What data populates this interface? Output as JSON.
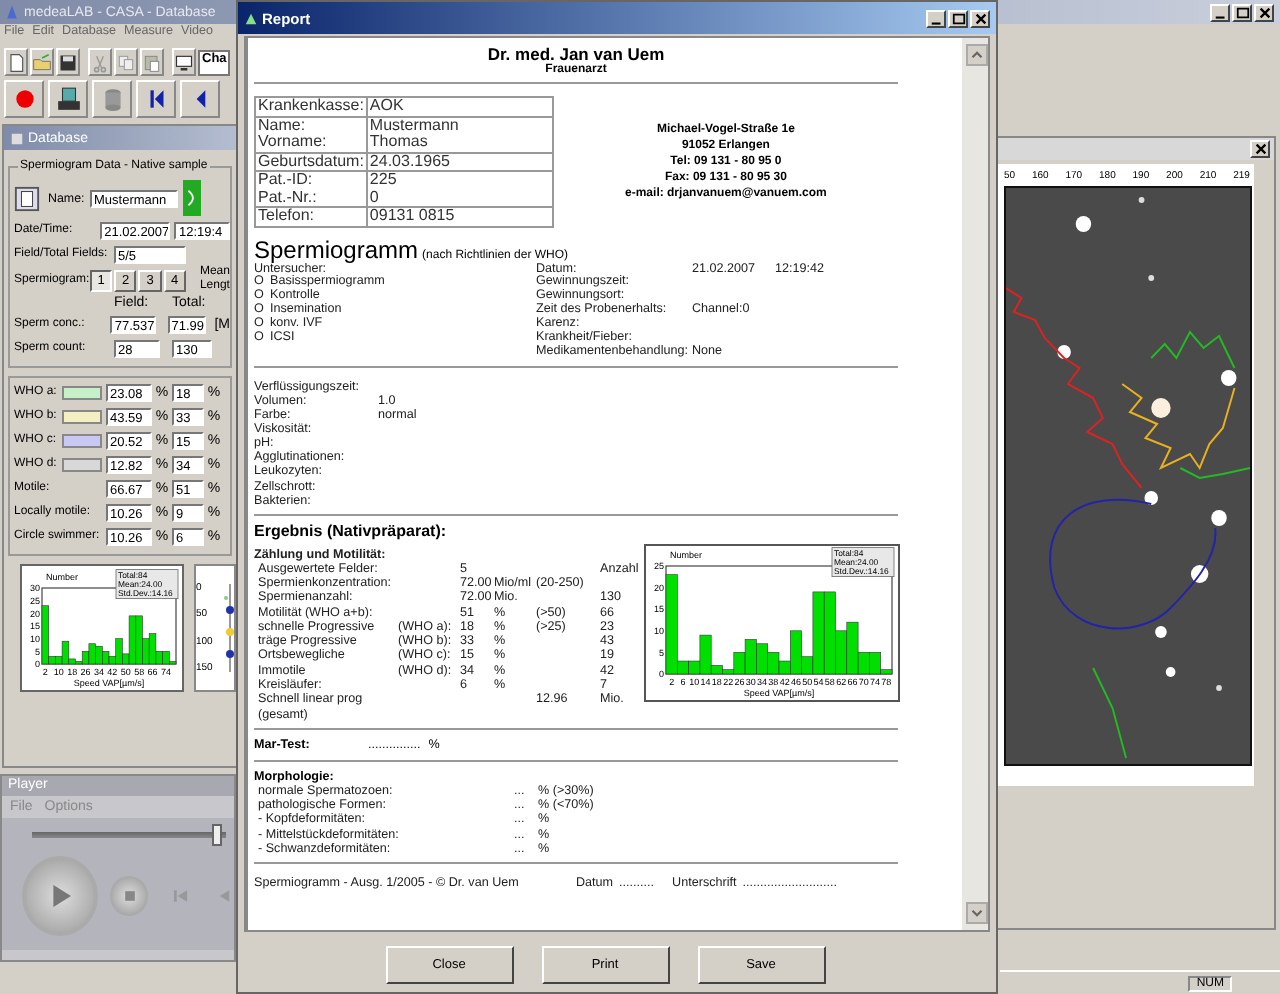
{
  "app_window": {
    "title": "medeaLAB - CASA - Database",
    "menu": [
      "File",
      "Edit",
      "Database",
      "Measure",
      "Video"
    ],
    "toolbar_combo": "Cha"
  },
  "database": {
    "title": "Database",
    "group_title": "Spermiogram Data - Native sample",
    "name_label": "Name:",
    "name_value": "Mustermann",
    "datetime_label": "Date/Time:",
    "date": "21.02.2007",
    "time": "12:19:4",
    "fields_label": "Field/Total Fields:",
    "fields_value": "5/5",
    "spermiogram_label": "Spermiogram:",
    "spermiogram_tabs": [
      {
        "label": "1",
        "selected": true
      },
      {
        "label": "2",
        "selected": false
      },
      {
        "label": "3",
        "selected": false
      },
      {
        "label": "4",
        "selected": false
      }
    ],
    "side_labels": [
      "Mean",
      "Lengt"
    ],
    "col_headers": [
      "Field:",
      "Total:"
    ],
    "metrics": [
      {
        "label": "Sperm conc.:",
        "field": "77.537",
        "total": "71.99",
        "unit": "[M"
      },
      {
        "label": "Sperm count:",
        "field": "28",
        "total": "130"
      }
    ],
    "who_rows": [
      {
        "label": "WHO a:",
        "color": "#c8f0c8",
        "field": "23.08",
        "field_unit": "%",
        "total": "18",
        "total_unit": "%"
      },
      {
        "label": "WHO b:",
        "color": "#f4eec0",
        "field": "43.59",
        "field_unit": "%",
        "total": "33",
        "total_unit": "%"
      },
      {
        "label": "WHO c:",
        "color": "#c8c8f4",
        "field": "20.52",
        "field_unit": "%",
        "total": "15",
        "total_unit": "%"
      },
      {
        "label": "WHO d:",
        "color": "#d8d8d8",
        "field": "12.82",
        "field_unit": "%",
        "total": "34",
        "total_unit": "%"
      },
      {
        "label": "Motile:",
        "field": "66.67",
        "field_unit": "%",
        "total": "51",
        "total_unit": "%"
      },
      {
        "label": "Locally motile:",
        "field": "10.26",
        "field_unit": "%",
        "total": "9",
        "total_unit": "%"
      },
      {
        "label": "Circle swimmer:",
        "field": "10.26",
        "field_unit": "%",
        "total": "6",
        "total_unit": "%"
      }
    ],
    "chart_data": {
      "type": "bar",
      "xlabel": "Speed VAP[µm/s]",
      "x": [
        2,
        6,
        10,
        14,
        18,
        22,
        26,
        30,
        34,
        38,
        42,
        46,
        50,
        54,
        58,
        62,
        66,
        70,
        74,
        78
      ],
      "series": [
        {
          "name": "Number",
          "color": "#00e000",
          "values": [
            23,
            3,
            3,
            9,
            2,
            1,
            5,
            8,
            7,
            5,
            3,
            10,
            4,
            19,
            19,
            10,
            12,
            5,
            5,
            1
          ]
        }
      ],
      "xlim": [
        0,
        80
      ],
      "ylim": [
        0,
        30
      ],
      "xticks": [
        2,
        10,
        18,
        26,
        34,
        42,
        50,
        58,
        66,
        74
      ],
      "yticks": [
        0,
        5,
        10,
        15,
        20,
        25,
        30
      ]
    },
    "chart_legend": [
      "Total:84",
      "Mean:24.00",
      "Std.Dev.:14.16"
    ],
    "side_plot_ticks": [
      "0",
      "50",
      "100",
      "150"
    ]
  },
  "player": {
    "title": "Player",
    "menu": [
      "File",
      "Options"
    ],
    "position": {
      "level": 0.98
    }
  },
  "report": {
    "title": "Report",
    "doctor": "Dr. med. Jan van Uem",
    "specialty": "Frauenarzt",
    "patient_table": [
      {
        "labels": [
          "Krankenkasse:"
        ],
        "values": [
          "AOK"
        ]
      },
      {
        "labels": [
          "Name:",
          "Vorname:"
        ],
        "values": [
          "Mustermann",
          "Thomas"
        ]
      },
      {
        "labels": [
          "Geburtsdatum:"
        ],
        "values": [
          "24.03.1965"
        ]
      },
      {
        "labels": [
          "Pat.-ID:",
          "Pat.-Nr.:"
        ],
        "values": [
          "225",
          "0"
        ]
      },
      {
        "labels": [
          "Telefon:"
        ],
        "values": [
          "09131 0815"
        ]
      }
    ],
    "address": [
      "Michael-Vogel-Straße 1e",
      "91052 Erlangen",
      "Tel: 09 131 - 80 95 0",
      "Fax: 09 131 - 80 95 30",
      "e-mail: drjanvanuem@vanuem.com"
    ],
    "section_title": "Spermiogramm",
    "section_subtitle": "(nach Richtlinien der WHO)",
    "examiner_label": "Untersucher:",
    "exam_types": [
      {
        "mark": "O",
        "label": "Basisspermiogramm"
      },
      {
        "mark": "O",
        "label": "Kontrolle"
      },
      {
        "mark": "O",
        "label": "Insemination"
      },
      {
        "mark": "O",
        "label": "konv. IVF"
      },
      {
        "mark": "O",
        "label": "ICSI"
      }
    ],
    "sample_info": [
      {
        "label": "Datum:",
        "value": "21.02.2007",
        "value_2": "12:19:42"
      },
      {
        "label": "Gewinnungszeit:"
      },
      {
        "label": "Gewinnungsort:"
      },
      {
        "label": "Zeit des Probenerhalts:",
        "value": "Channel:0"
      },
      {
        "label": "Karenz:"
      },
      {
        "label": "Krankheit/Fieber:"
      },
      {
        "label": "Medikamentenbehandlung:",
        "value": "None"
      }
    ],
    "physical": [
      {
        "label": "Verflüssigungszeit:"
      },
      {
        "label": "Volumen:",
        "value": "1.0"
      },
      {
        "label": "Farbe:",
        "value": "normal"
      },
      {
        "label": "Viskosität:"
      },
      {
        "label": "pH:"
      },
      {
        "label": "Agglutinationen:"
      },
      {
        "label": "Leukozyten:"
      },
      {
        "label": "Zellschrott:"
      },
      {
        "label": "Bakterien:"
      }
    ],
    "result_title": "Ergebnis (Nativpräparat):",
    "motility_title": "Zählung und Motilität:",
    "motility_rows": [
      {
        "label": "Ausgewertete Felder:",
        "value": "5",
        "count": "Anzahl"
      },
      {
        "label": "Spermienkonzentration:",
        "value": "72.00",
        "unit": "Mio/ml",
        "ref": "(20-250)"
      },
      {
        "label": "Spermienanzahl:",
        "value": "72.00",
        "unit": "Mio.",
        "count": "130"
      },
      {
        "label": "Motilität (WHO a+b):",
        "value": "51",
        "unit": "%",
        "ref": "(>50)",
        "count": "66"
      },
      {
        "label": "schnelle Progressive",
        "who": "(WHO a):",
        "value": "18",
        "unit": "%",
        "ref": "(>25)",
        "count": "23"
      },
      {
        "label": "träge Progressive",
        "who": "(WHO b):",
        "value": "33",
        "unit": "%",
        "count": "43"
      },
      {
        "label": "Ortsbewegliche",
        "who": "(WHO c):",
        "value": "15",
        "unit": "%",
        "count": "19"
      },
      {
        "label": "Immotile",
        "who": "(WHO d):",
        "value": "34",
        "unit": "%",
        "count": "42"
      },
      {
        "label": "Kreisläufer:",
        "value": "6",
        "unit": "%",
        "count": "7"
      },
      {
        "label": "Schnell linear prog (gesamt)",
        "ref": "12.96",
        "count": "Mio."
      }
    ],
    "chart_data": {
      "type": "bar",
      "xlabel": "Speed VAP[µm/s]",
      "x": [
        2,
        6,
        10,
        14,
        18,
        22,
        26,
        30,
        34,
        38,
        42,
        46,
        50,
        54,
        58,
        62,
        66,
        70,
        74,
        78
      ],
      "series": [
        {
          "name": "Number",
          "color": "#00e000",
          "values": [
            23,
            3,
            3,
            9,
            2,
            1,
            5,
            8,
            7,
            5,
            3,
            10,
            4,
            19,
            19,
            10,
            12,
            5,
            5,
            1
          ]
        }
      ],
      "xlim": [
        0,
        80
      ],
      "ylim": [
        0,
        25
      ],
      "xticks": [
        2,
        6,
        10,
        14,
        18,
        22,
        26,
        30,
        34,
        38,
        42,
        46,
        50,
        54,
        58,
        62,
        66,
        70,
        74,
        78
      ],
      "yticks": [
        0,
        5,
        10,
        15,
        20,
        25
      ]
    },
    "chart_legend": [
      "Total:84",
      "Mean:24.00",
      "Std.Dev.:14.16"
    ],
    "mar_test": {
      "label": "Mar-Test:",
      "blank": "...............",
      "unit": "%"
    },
    "morphology_title": "Morphologie:",
    "morphology_rows": [
      {
        "label": "normale Spermatozoen:",
        "value": "...",
        "unit": "% (>30%)"
      },
      {
        "label": "pathologische Formen:",
        "value": "...",
        "unit": "% (<70%)"
      },
      {
        "label": "- Kopfdeformitäten:",
        "value": "...",
        "unit": "%"
      },
      {
        "label": "- Mittelstückdeformitäten:",
        "value": "...",
        "unit": "%"
      },
      {
        "label": "- Schwanzdeformitäten:",
        "value": "...",
        "unit": "%"
      }
    ],
    "footer": {
      "text": "Spermiogramm - Ausg. 1/2005 - © Dr. van Uem",
      "date_label": "Datum",
      "date_blank": "..........",
      "signature_label": "Unterschrift",
      "signature_blank": "..........................."
    },
    "buttons": [
      "Close",
      "Print",
      "Save"
    ]
  },
  "image_window": {
    "ruler_labels": [
      "50",
      "160",
      "170",
      "180",
      "190",
      "200",
      "210",
      "219"
    ]
  },
  "status_bar": {
    "indicator": "NUM"
  }
}
